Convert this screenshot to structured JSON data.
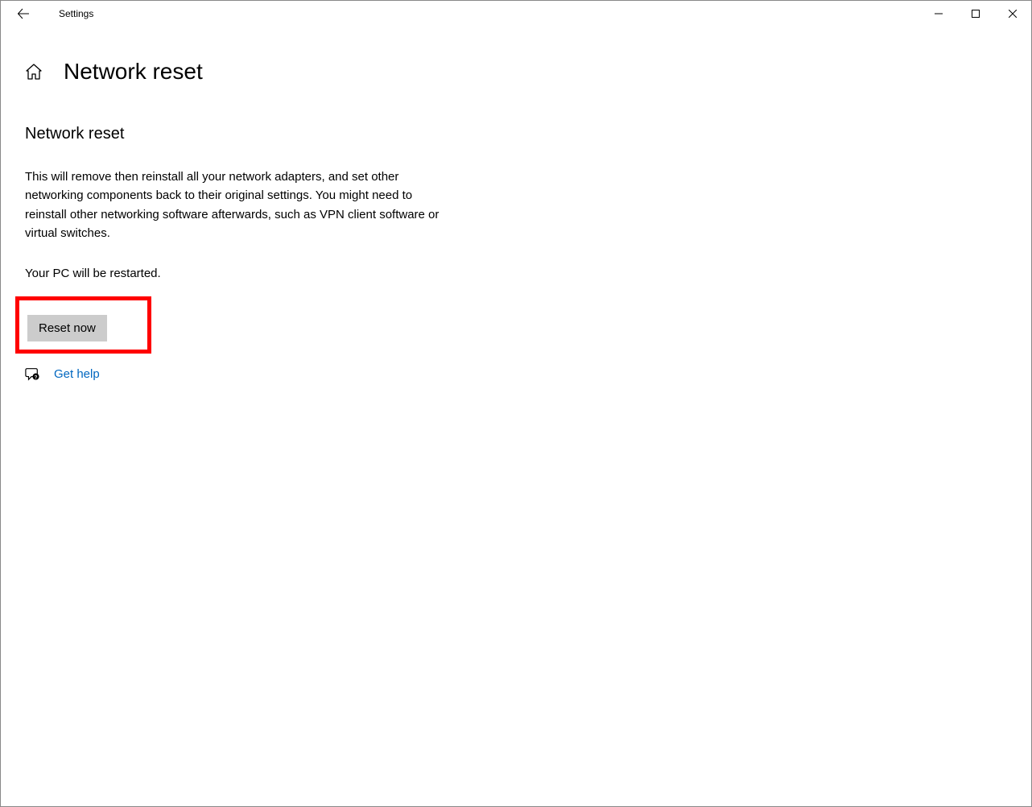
{
  "window": {
    "title": "Settings"
  },
  "page": {
    "title": "Network reset",
    "heading": "Network reset",
    "description": "This will remove then reinstall all your network adapters, and set other networking components back to their original settings. You might need to reinstall other networking software afterwards, such as VPN client software or virtual switches.",
    "restart_note": "Your PC will be restarted.",
    "reset_button": "Reset now",
    "help_link": "Get help"
  }
}
